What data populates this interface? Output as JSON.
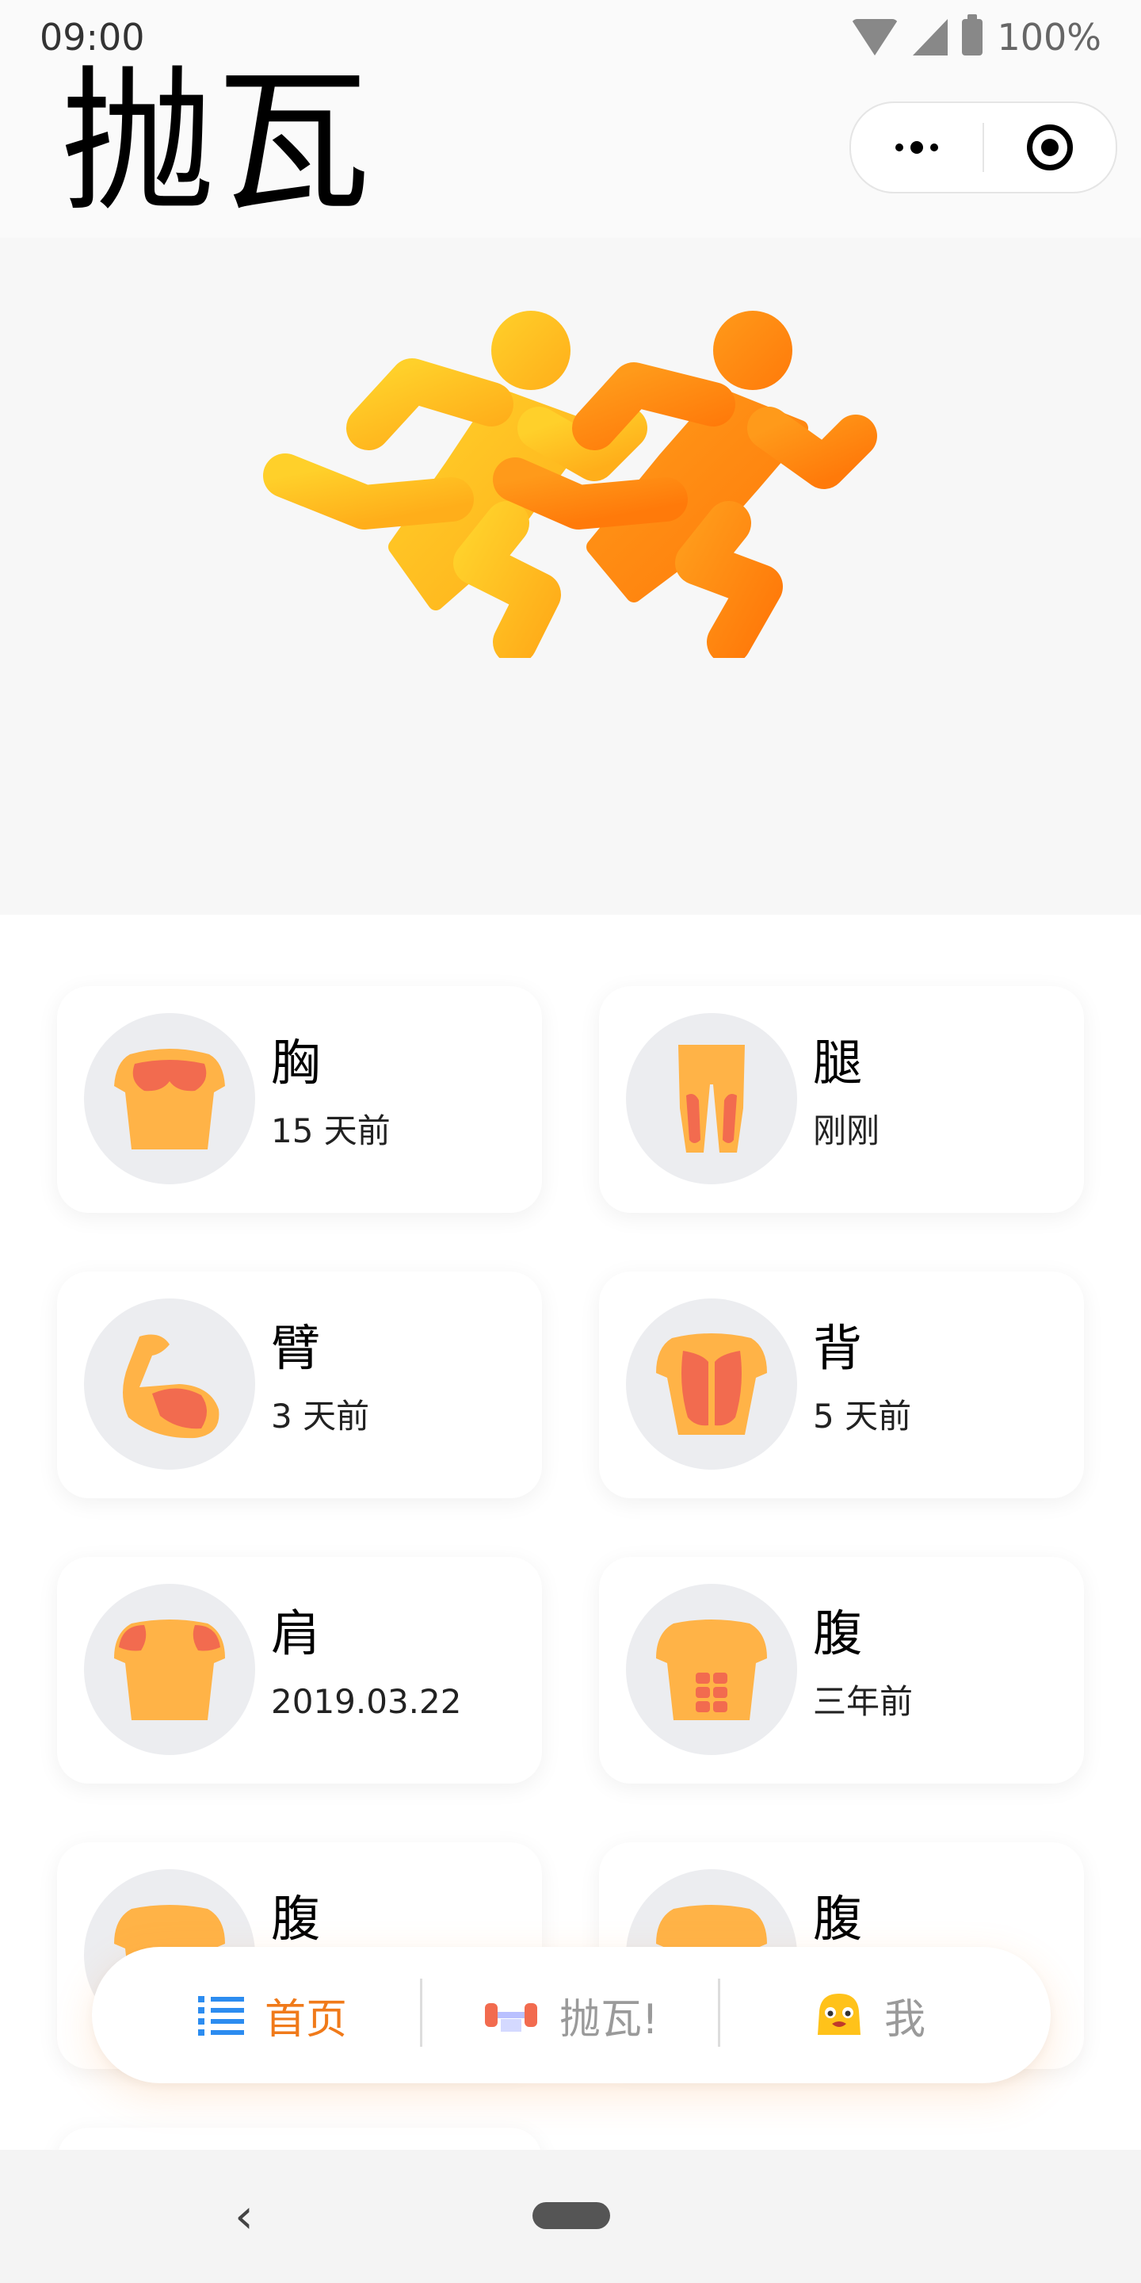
{
  "status": {
    "time": "09:00",
    "battery": "100%"
  },
  "header": {
    "title": "抛瓦"
  },
  "capsule": {
    "more_icon": "more-icon",
    "close_icon": "target-icon"
  },
  "hero": {
    "logo_icon": "runners-logo"
  },
  "muscles": [
    {
      "name": "胸",
      "time": "15 天前",
      "icon": "chest-icon"
    },
    {
      "name": "腿",
      "time": "刚刚",
      "icon": "legs-icon"
    },
    {
      "name": "臂",
      "time": "3 天前",
      "icon": "arm-icon"
    },
    {
      "name": "背",
      "time": "5 天前",
      "icon": "back-icon"
    },
    {
      "name": "肩",
      "time": "2019.03.22",
      "icon": "shoulder-icon"
    },
    {
      "name": "腹",
      "time": "三年前",
      "icon": "abs-icon"
    },
    {
      "name": "腹",
      "time": "",
      "icon": "torso-icon"
    },
    {
      "name": "腹",
      "time": "",
      "icon": "torso-icon"
    }
  ],
  "tabbar": {
    "home": {
      "label": "首页",
      "icon": "list-icon"
    },
    "lift": {
      "label": "抛瓦!",
      "icon": "dumbbell-icon"
    },
    "me": {
      "label": "我",
      "icon": "face-icon"
    }
  },
  "colors": {
    "accent": "#f07a1a",
    "inactive": "#9a9a9a",
    "body": "#ffb347",
    "muscle": "#f26b4f"
  }
}
